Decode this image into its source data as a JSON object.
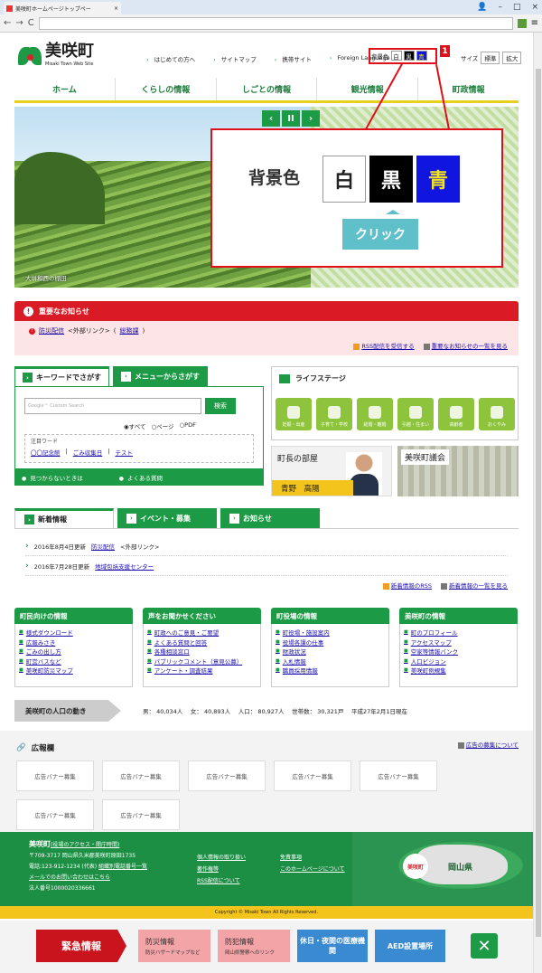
{
  "browser": {
    "tab_title": "美咲町ホームページトップペー",
    "close_tab": "×",
    "win_min": "–",
    "win_max": "□",
    "win_close": "×",
    "back": "←",
    "forward": "→",
    "reload": "C",
    "menu": "≡"
  },
  "header": {
    "logo_ja": "美咲町",
    "logo_en": "Misaki Town Web Site",
    "toplinks": [
      "はじめての方へ",
      "サイトマップ",
      "携帯サイト",
      "Foreign Language"
    ],
    "bg_label": "背景色",
    "bg_white": "白",
    "bg_black": "黒",
    "bg_blue": "青",
    "font_label": "サイズ",
    "font_normal": "標準",
    "font_large": "拡大",
    "callout_num": "1"
  },
  "nav": [
    "ホーム",
    "くらしの情報",
    "しごとの情報",
    "観光情報",
    "町政情報"
  ],
  "hero": {
    "caption": "大垪和西の棚田",
    "prev": "‹",
    "pause": "II",
    "next": "›"
  },
  "zoom": {
    "label": "背景色",
    "white": "白",
    "black": "黒",
    "blue": "青",
    "click": "クリック"
  },
  "notice": {
    "title": "重要なお知らせ",
    "item_link": "防災配信",
    "item_ext": "<外部リンク>",
    "item_dept": "総務課",
    "rss": "RSS配信を受信する",
    "list": "重要なお知らせの一覧を見る"
  },
  "search": {
    "tab1": "キーワードでさがす",
    "tab2": "メニューからさがす",
    "placeholder": "Google™ Custom Search",
    "button": "検索",
    "r_all": "◉すべて",
    "r_page": "○ページ",
    "r_pdf": "○PDF",
    "focus_title": "注目ワード",
    "focus": [
      "〇〇記念館",
      "ごみ収集日",
      "テスト"
    ],
    "foot1": "見つからないときは",
    "foot2": "よくある質問"
  },
  "life": {
    "title": "ライフステージ",
    "items": [
      "妊娠・出産",
      "子育て・学校",
      "結婚・離婚",
      "引越・住まい",
      "高齢者",
      "おくやみ"
    ]
  },
  "mayor": {
    "title": "町長の部屋",
    "name": "青野　高陽"
  },
  "council": {
    "title": "美咲町議会"
  },
  "news": {
    "tab1": "新着情報",
    "tab2": "イベント・募集",
    "tab3": "お知らせ",
    "items": [
      {
        "date": "2016年8月4日更新",
        "link": "防災配信",
        "ext": "<外部リンク>"
      },
      {
        "date": "2016年7月28日更新",
        "link": "地域包括支援センター",
        "ext": ""
      }
    ],
    "rss": "新着情報のRSS",
    "list": "新着情報の一覧を見る"
  },
  "cols": [
    {
      "title": "町民向けの情報",
      "items": [
        "様式ダウンロード",
        "広報みさき",
        "ごみの出し方",
        "町営バスなど",
        "美咲町防災マップ"
      ]
    },
    {
      "title": "声をお聞かせください",
      "items": [
        "町政へのご意見・ご要望",
        "よくある質問と回答",
        "各種相談窓口",
        "パブリックコメント（意見公募）",
        "アンケート・調査結果"
      ]
    },
    {
      "title": "町役場の情報",
      "items": [
        "町役場・施設案内",
        "役場各課の仕事",
        "財政状況",
        "入札情報",
        "職員採用情報"
      ]
    },
    {
      "title": "美咲町の情報",
      "items": [
        "町のプロフィール",
        "アクセスマップ",
        "空家等情報バンク",
        "人口ビジョン",
        "美咲町例規集"
      ]
    }
  ],
  "population": {
    "title": "美咲町の人口の動き",
    "values": "男： 40,034人　 女： 40,893人　 人口： 80,927人　 世帯数： 30,321戸　 平成27年2月1日現在"
  },
  "ads": {
    "title": "広報欄",
    "recruit": "広告の募集について",
    "banner": "広告バナー募集",
    "count": 7
  },
  "footer": {
    "name": "美咲町",
    "access": "(役場のアクセス・開庁時間)",
    "addr": "〒709-3717 岡山県久米郡美咲町原田1735",
    "tel": "電話:123-912-1234 (代表)",
    "tel_link": "組織別電話番号一覧",
    "mail": "メールでのお問い合わせはこちら",
    "corp": "法人番号1000020336661",
    "b": [
      "個人情報の取り扱い",
      "著作権等",
      "RSS配信について"
    ],
    "c": [
      "免責事項",
      "このホームページについて"
    ],
    "map_pin": "美咲町",
    "map_pref": "岡山県"
  },
  "copyright": "Copyright © Misaki Town All Rights Reserved.",
  "emergency": {
    "title": "緊急情報",
    "b1": "防災情報",
    "b1s": "防災ハザードマップなど",
    "b2": "防犯情報",
    "b2s": "岡山県警察へのリンク",
    "b3": "休日・夜間の医療機関",
    "b4": "AED設置場所",
    "close": "✕"
  }
}
